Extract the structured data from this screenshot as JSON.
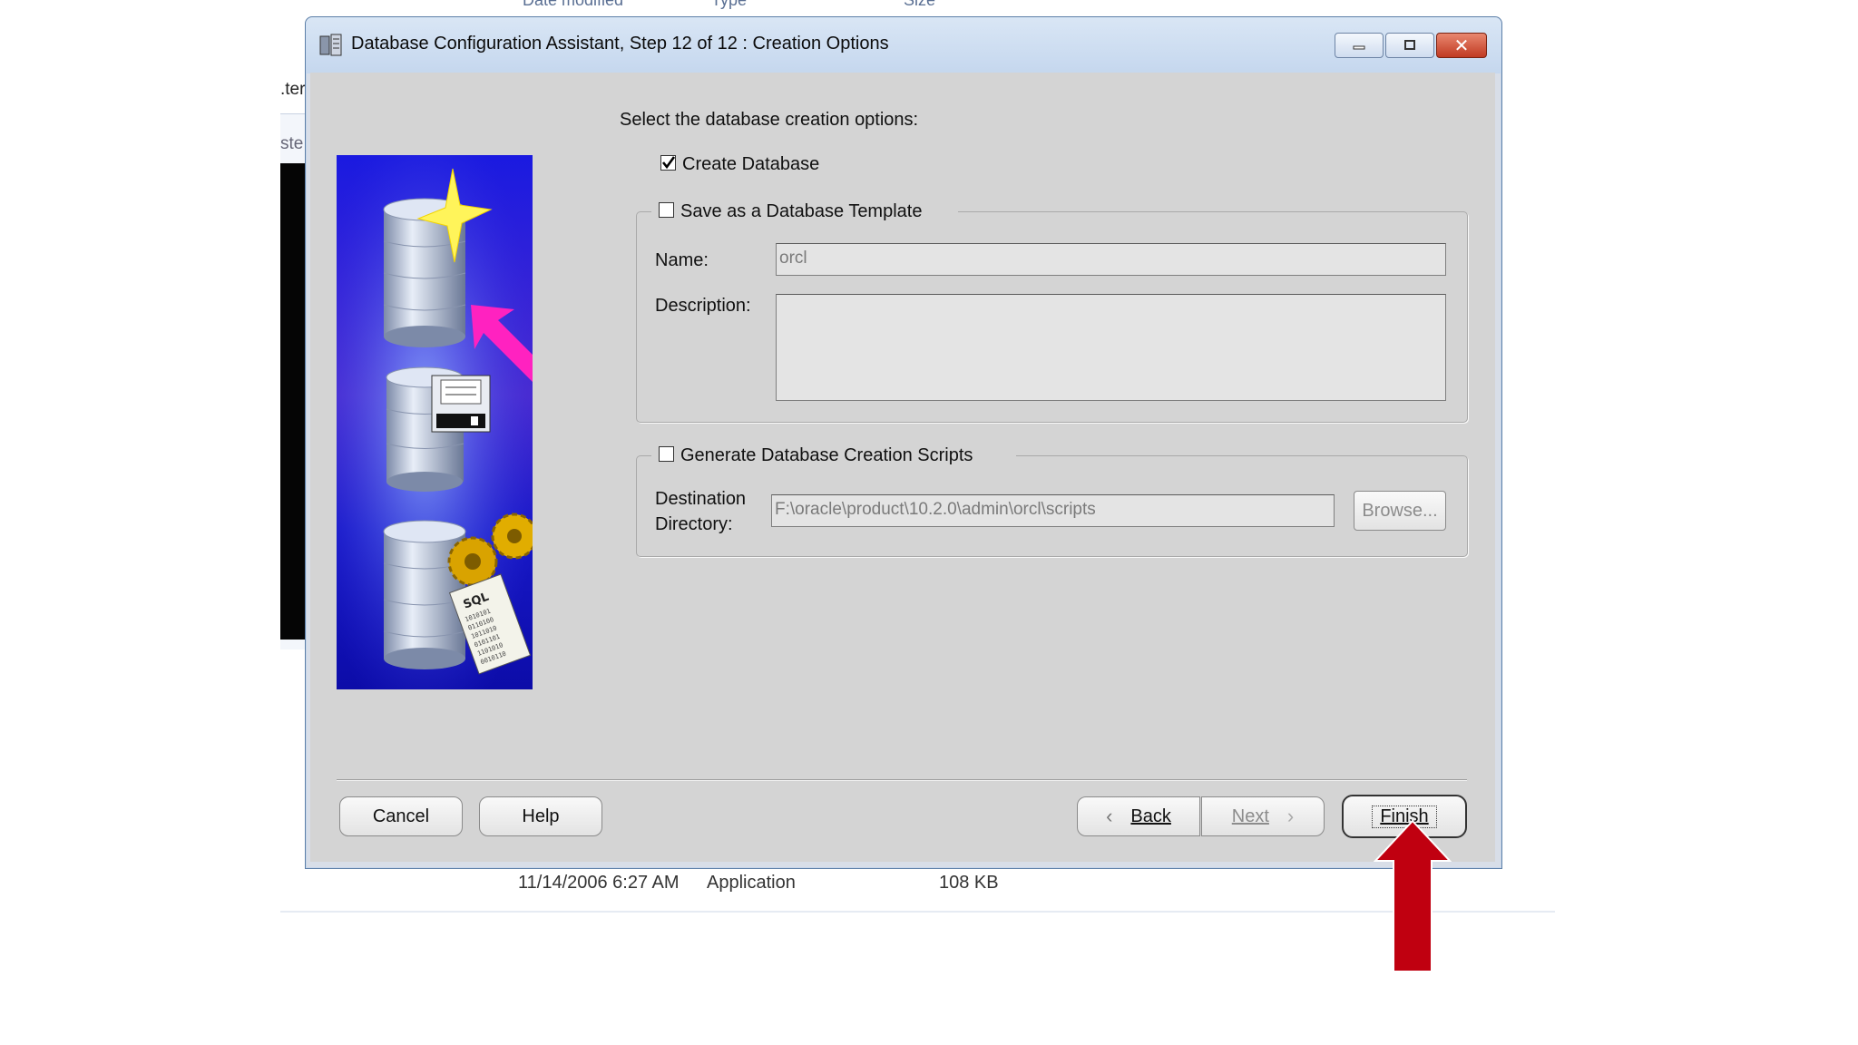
{
  "background": {
    "column_headers": [
      "Date modified",
      "Type",
      "Size"
    ],
    "left_fragments": [
      ".ter",
      "ste"
    ],
    "file_row": {
      "date": "11/14/2006 6:27 AM",
      "type": "Application",
      "size": "108 KB"
    }
  },
  "window": {
    "title": "Database Configuration Assistant, Step 12 of 12 : Creation Options",
    "icon": "database-assistant-icon",
    "controls": {
      "minimize": "minimize-icon",
      "maximize": "maximize-icon",
      "close": "close-icon"
    }
  },
  "form": {
    "prompt": "Select the database creation options:",
    "create_database": {
      "label": "Create Database",
      "checked": true
    },
    "save_template": {
      "label": "Save as a Database Template",
      "checked": false,
      "name_label": "Name:",
      "name_value": "orcl",
      "description_label": "Description:",
      "description_value": ""
    },
    "generate_scripts": {
      "label": "Generate Database Creation Scripts",
      "checked": false,
      "destination_label_1": "Destination",
      "destination_label_2": "Directory:",
      "destination_value": "F:\\oracle\\product\\10.2.0\\admin\\orcl\\scripts",
      "browse_label": "Browse..."
    }
  },
  "buttons": {
    "cancel": "Cancel",
    "help": "Help",
    "back": "Back",
    "next": "Next",
    "finish": "Finish"
  },
  "colors": {
    "accent_red_arrow": "#c00010",
    "illustration_blue": "#1010d8",
    "dialog_bg": "#d4d4d4"
  }
}
